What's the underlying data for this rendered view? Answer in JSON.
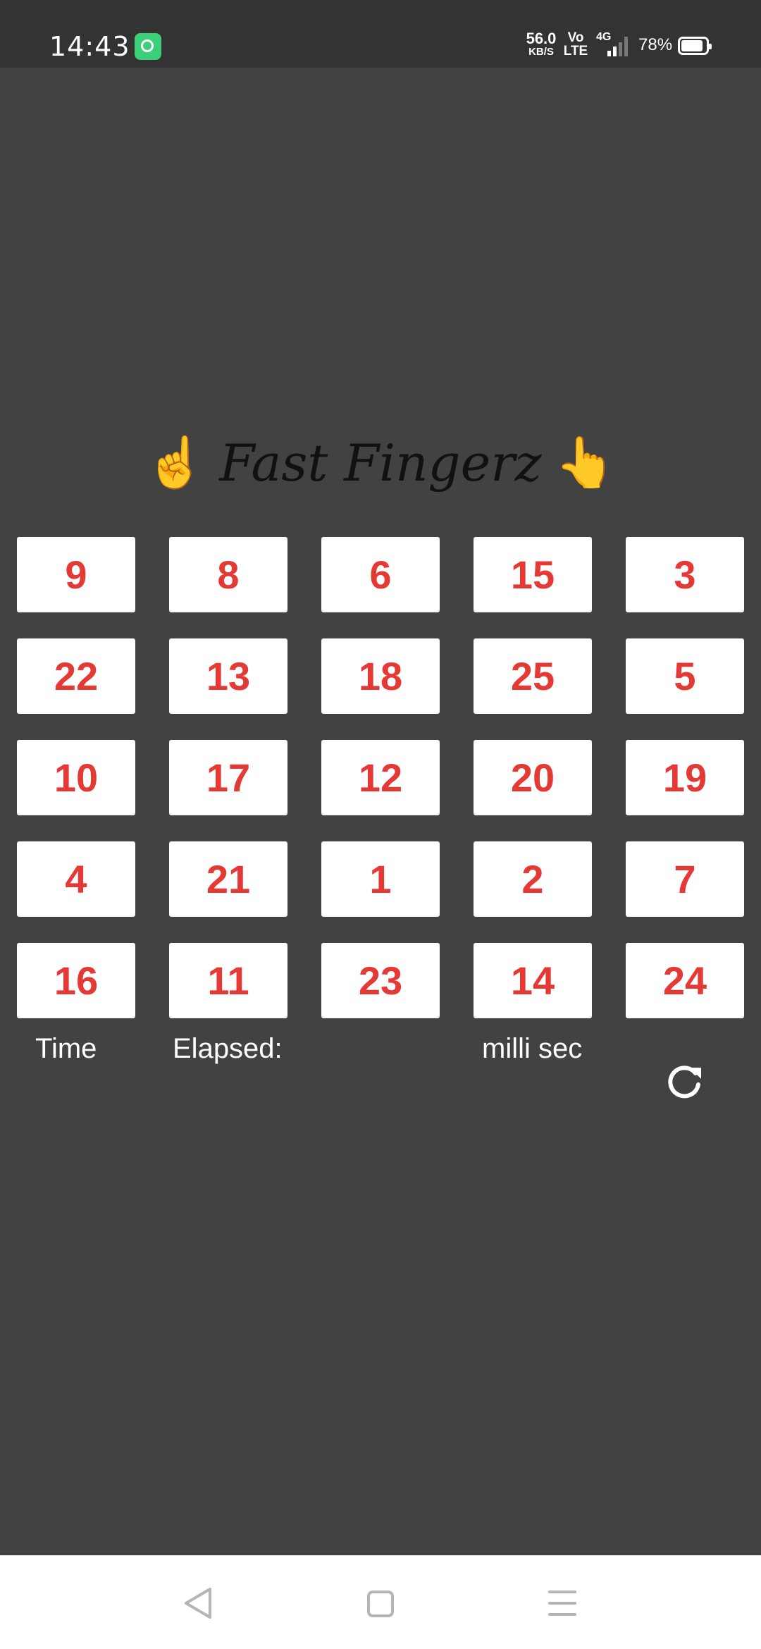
{
  "status_bar": {
    "time": "14:43",
    "network_speed": "56.0",
    "network_unit": "KB/S",
    "volte_top": "Vo",
    "volte_bottom": "LTE",
    "signal_type": "4G",
    "battery": "78%",
    "battery_level": 0.78,
    "icons": [
      "app-notification-icon",
      "signal-icon",
      "battery-icon"
    ]
  },
  "app": {
    "title": "Fast Fingerz",
    "left_emoji": "☝",
    "right_emoji": "👆",
    "title_color": "#111111"
  },
  "grid": {
    "tiles": [
      "9",
      "8",
      "6",
      "15",
      "3",
      "22",
      "13",
      "18",
      "25",
      "5",
      "10",
      "17",
      "12",
      "20",
      "19",
      "4",
      "21",
      "1",
      "2",
      "7",
      "16",
      "11",
      "23",
      "14",
      "24"
    ],
    "tile_text_color": "#e53935",
    "tile_background": "#ffffff"
  },
  "timer": {
    "time_label": "Time",
    "elapsed_label": "Elapsed:",
    "unit_label": "milli sec",
    "refresh_icon": "refresh-icon"
  },
  "nav_bar": {
    "icons": [
      "back-icon",
      "home-icon",
      "menu-icon"
    ]
  },
  "colors": {
    "background": "#424242",
    "status_bar": "#333333",
    "nav_bar": "#ffffff"
  }
}
